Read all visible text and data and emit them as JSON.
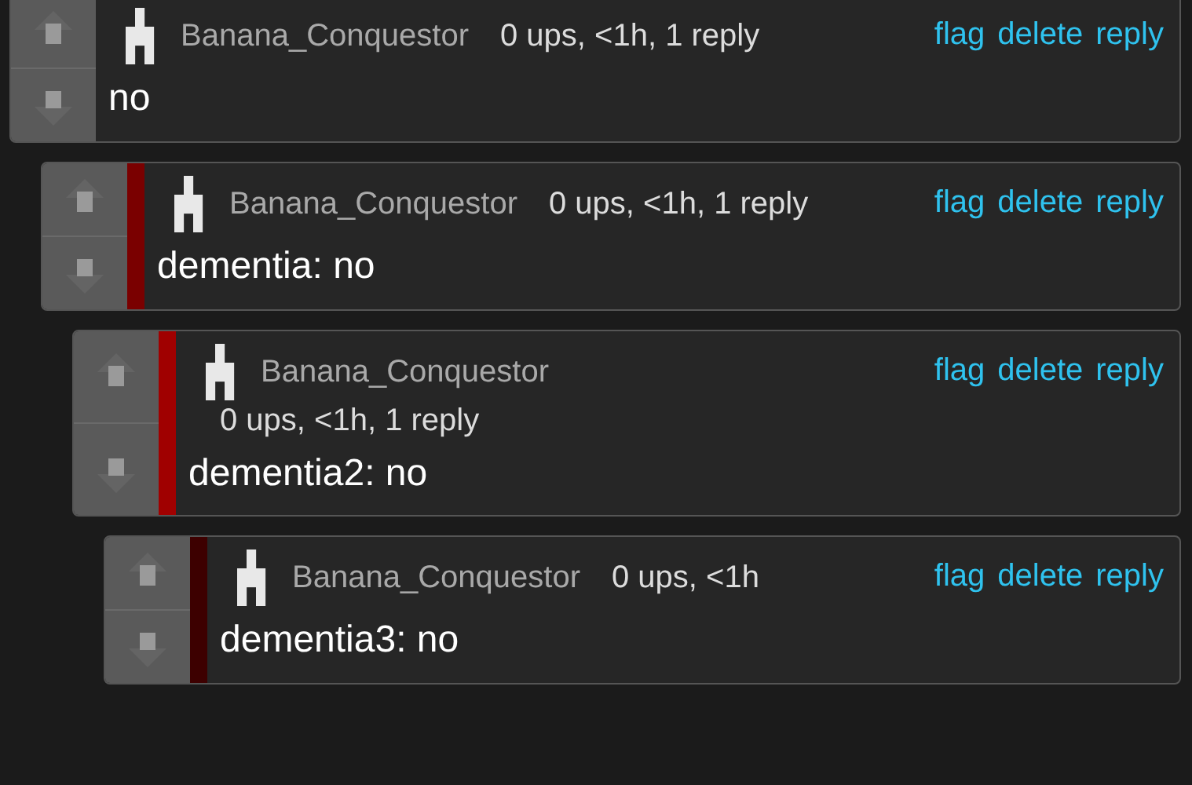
{
  "comments": [
    {
      "author": "Banana_Conquestor",
      "meta": "0 ups, <1h, 1 reply",
      "actions": [
        "flag",
        "delete",
        "reply"
      ],
      "text": "no",
      "children": [
        {
          "author": "Banana_Conquestor",
          "meta": "0 ups, <1h, 1 reply",
          "actions": [
            "flag",
            "delete",
            "reply"
          ],
          "text": "dementia: no",
          "color": "#7a0000",
          "children": [
            {
              "author": "Banana_Conquestor",
              "meta": "0 ups, <1h, 1 reply",
              "actions": [
                "flag",
                "delete",
                "reply"
              ],
              "text": "dementia2: no",
              "color": "#a00000",
              "children": [
                {
                  "author": "Banana_Conquestor",
                  "meta": "0 ups, <1h",
                  "actions": [
                    "flag",
                    "delete",
                    "reply"
                  ],
                  "text": "dementia3: no",
                  "color": "#3d0000"
                }
              ]
            }
          ]
        }
      ]
    }
  ]
}
